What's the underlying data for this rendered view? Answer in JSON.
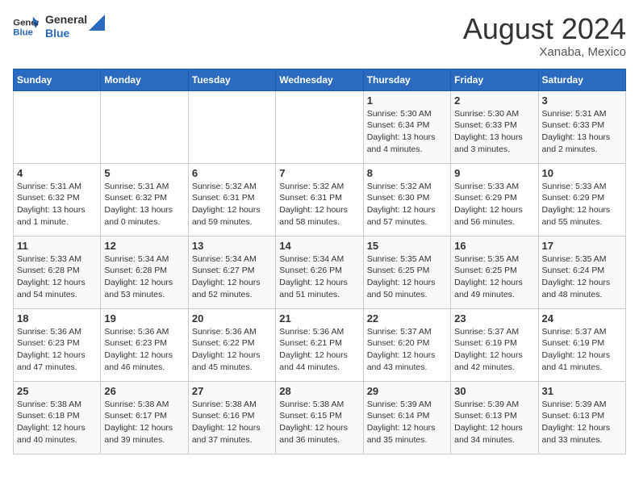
{
  "header": {
    "logo_line1": "General",
    "logo_line2": "Blue",
    "title": "August 2024",
    "subtitle": "Xanaba, Mexico"
  },
  "weekdays": [
    "Sunday",
    "Monday",
    "Tuesday",
    "Wednesday",
    "Thursday",
    "Friday",
    "Saturday"
  ],
  "weeks": [
    [
      {
        "num": "",
        "info": ""
      },
      {
        "num": "",
        "info": ""
      },
      {
        "num": "",
        "info": ""
      },
      {
        "num": "",
        "info": ""
      },
      {
        "num": "1",
        "info": "Sunrise: 5:30 AM\nSunset: 6:34 PM\nDaylight: 13 hours\nand 4 minutes."
      },
      {
        "num": "2",
        "info": "Sunrise: 5:30 AM\nSunset: 6:33 PM\nDaylight: 13 hours\nand 3 minutes."
      },
      {
        "num": "3",
        "info": "Sunrise: 5:31 AM\nSunset: 6:33 PM\nDaylight: 13 hours\nand 2 minutes."
      }
    ],
    [
      {
        "num": "4",
        "info": "Sunrise: 5:31 AM\nSunset: 6:32 PM\nDaylight: 13 hours\nand 1 minute."
      },
      {
        "num": "5",
        "info": "Sunrise: 5:31 AM\nSunset: 6:32 PM\nDaylight: 13 hours\nand 0 minutes."
      },
      {
        "num": "6",
        "info": "Sunrise: 5:32 AM\nSunset: 6:31 PM\nDaylight: 12 hours\nand 59 minutes."
      },
      {
        "num": "7",
        "info": "Sunrise: 5:32 AM\nSunset: 6:31 PM\nDaylight: 12 hours\nand 58 minutes."
      },
      {
        "num": "8",
        "info": "Sunrise: 5:32 AM\nSunset: 6:30 PM\nDaylight: 12 hours\nand 57 minutes."
      },
      {
        "num": "9",
        "info": "Sunrise: 5:33 AM\nSunset: 6:29 PM\nDaylight: 12 hours\nand 56 minutes."
      },
      {
        "num": "10",
        "info": "Sunrise: 5:33 AM\nSunset: 6:29 PM\nDaylight: 12 hours\nand 55 minutes."
      }
    ],
    [
      {
        "num": "11",
        "info": "Sunrise: 5:33 AM\nSunset: 6:28 PM\nDaylight: 12 hours\nand 54 minutes."
      },
      {
        "num": "12",
        "info": "Sunrise: 5:34 AM\nSunset: 6:28 PM\nDaylight: 12 hours\nand 53 minutes."
      },
      {
        "num": "13",
        "info": "Sunrise: 5:34 AM\nSunset: 6:27 PM\nDaylight: 12 hours\nand 52 minutes."
      },
      {
        "num": "14",
        "info": "Sunrise: 5:34 AM\nSunset: 6:26 PM\nDaylight: 12 hours\nand 51 minutes."
      },
      {
        "num": "15",
        "info": "Sunrise: 5:35 AM\nSunset: 6:25 PM\nDaylight: 12 hours\nand 50 minutes."
      },
      {
        "num": "16",
        "info": "Sunrise: 5:35 AM\nSunset: 6:25 PM\nDaylight: 12 hours\nand 49 minutes."
      },
      {
        "num": "17",
        "info": "Sunrise: 5:35 AM\nSunset: 6:24 PM\nDaylight: 12 hours\nand 48 minutes."
      }
    ],
    [
      {
        "num": "18",
        "info": "Sunrise: 5:36 AM\nSunset: 6:23 PM\nDaylight: 12 hours\nand 47 minutes."
      },
      {
        "num": "19",
        "info": "Sunrise: 5:36 AM\nSunset: 6:23 PM\nDaylight: 12 hours\nand 46 minutes."
      },
      {
        "num": "20",
        "info": "Sunrise: 5:36 AM\nSunset: 6:22 PM\nDaylight: 12 hours\nand 45 minutes."
      },
      {
        "num": "21",
        "info": "Sunrise: 5:36 AM\nSunset: 6:21 PM\nDaylight: 12 hours\nand 44 minutes."
      },
      {
        "num": "22",
        "info": "Sunrise: 5:37 AM\nSunset: 6:20 PM\nDaylight: 12 hours\nand 43 minutes."
      },
      {
        "num": "23",
        "info": "Sunrise: 5:37 AM\nSunset: 6:19 PM\nDaylight: 12 hours\nand 42 minutes."
      },
      {
        "num": "24",
        "info": "Sunrise: 5:37 AM\nSunset: 6:19 PM\nDaylight: 12 hours\nand 41 minutes."
      }
    ],
    [
      {
        "num": "25",
        "info": "Sunrise: 5:38 AM\nSunset: 6:18 PM\nDaylight: 12 hours\nand 40 minutes."
      },
      {
        "num": "26",
        "info": "Sunrise: 5:38 AM\nSunset: 6:17 PM\nDaylight: 12 hours\nand 39 minutes."
      },
      {
        "num": "27",
        "info": "Sunrise: 5:38 AM\nSunset: 6:16 PM\nDaylight: 12 hours\nand 37 minutes."
      },
      {
        "num": "28",
        "info": "Sunrise: 5:38 AM\nSunset: 6:15 PM\nDaylight: 12 hours\nand 36 minutes."
      },
      {
        "num": "29",
        "info": "Sunrise: 5:39 AM\nSunset: 6:14 PM\nDaylight: 12 hours\nand 35 minutes."
      },
      {
        "num": "30",
        "info": "Sunrise: 5:39 AM\nSunset: 6:13 PM\nDaylight: 12 hours\nand 34 minutes."
      },
      {
        "num": "31",
        "info": "Sunrise: 5:39 AM\nSunset: 6:13 PM\nDaylight: 12 hours\nand 33 minutes."
      }
    ]
  ],
  "colors": {
    "header_bg": "#2a6abf",
    "header_text": "#ffffff"
  }
}
